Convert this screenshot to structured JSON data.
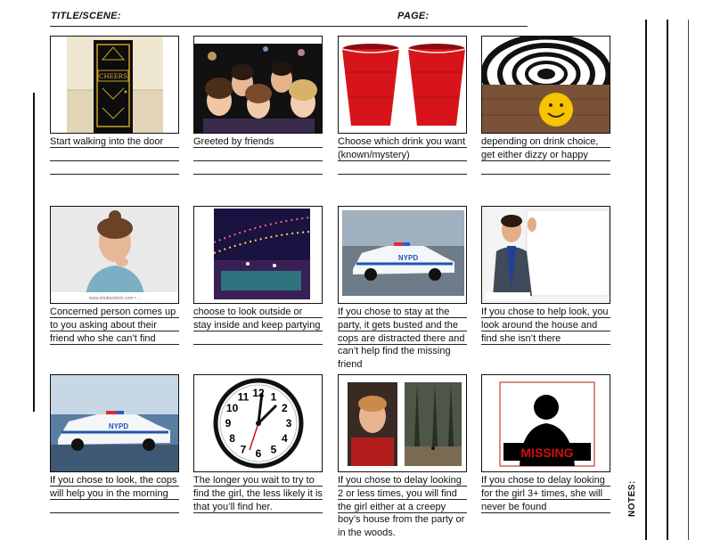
{
  "header": {
    "title_label": "TITLE/SCENE:",
    "page_label": "PAGE:"
  },
  "notes_label": "NOTES:",
  "panels": [
    {
      "caption": "Start walking into the door",
      "image_text": "CHEERS"
    },
    {
      "caption": "Greeted by friends"
    },
    {
      "caption": "Choose which drink you want (known/mystery)"
    },
    {
      "caption": "depending on drink choice, get either dizzy or happy"
    },
    {
      "caption": "Concerned person comes up to you asking about their friend who she can’t find",
      "image_text": "www.shutterstock.com • ..."
    },
    {
      "caption": "choose to look outside or stay inside and keep partying"
    },
    {
      "caption": "If you chose to stay at the party, it gets busted and the cops are distracted there and can’t help find the missing friend",
      "image_text": "NYPD"
    },
    {
      "caption": "If you chose to help look, you look around the house and find she isn’t there"
    },
    {
      "caption": "If you chose to look, the cops will help you in the morning",
      "image_text": "NYPD"
    },
    {
      "caption": "The longer you wait to try to find the girl, the less likely it is that you’ll find her.",
      "clock_numbers": [
        "12",
        "1",
        "2",
        "3",
        "4",
        "5",
        "6",
        "7",
        "8",
        "9",
        "10",
        "11"
      ]
    },
    {
      "caption": "If you chose to delay looking 2 or less times, you will find the girl either at a creepy boy’s house from the party or in the woods."
    },
    {
      "caption": "If you chose to delay looking for the girl 3+ times, she will never be found",
      "image_text": "MISSING"
    }
  ]
}
